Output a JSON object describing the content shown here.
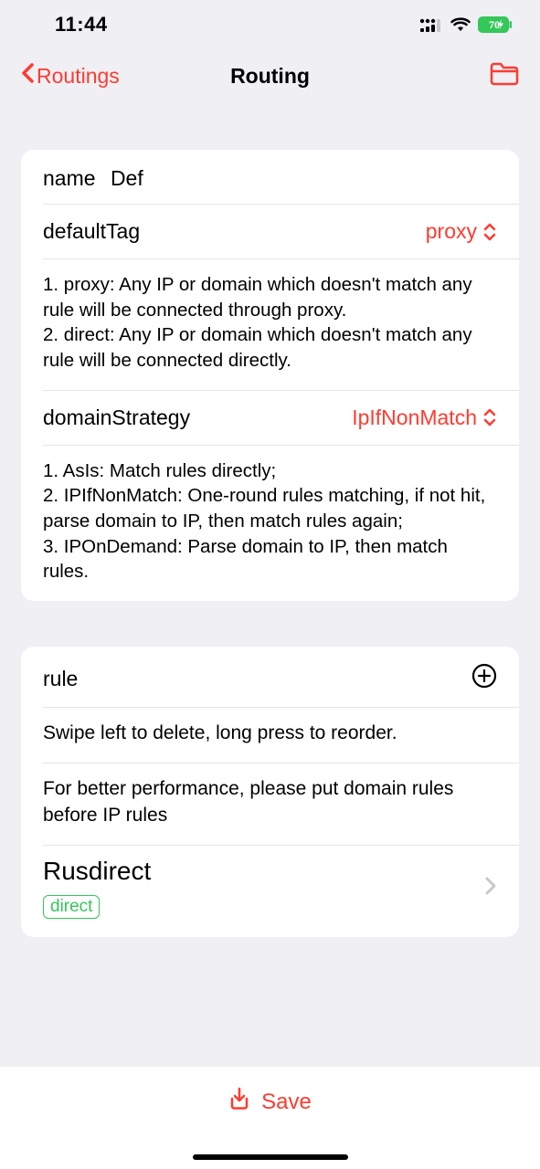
{
  "status": {
    "time": "11:44",
    "battery_text": "70"
  },
  "nav": {
    "back_label": "Routings",
    "title": "Routing"
  },
  "form": {
    "name_label": "name",
    "name_value": "Def",
    "defaultTag_label": "defaultTag",
    "defaultTag_value": "proxy",
    "defaultTag_desc": "1. proxy: Any IP or domain which doesn't match any rule will be connected through proxy.\n2. direct: Any IP or domain which doesn't match any rule will be connected directly.",
    "domainStrategy_label": "domainStrategy",
    "domainStrategy_value": "IpIfNonMatch",
    "domainStrategy_desc": "1. AsIs: Match rules directly;\n2. IPIfNonMatch: One-round rules matching, if not hit, parse domain to IP, then match rules again;\n3. IPOnDemand: Parse domain to IP, then match rules."
  },
  "rules": {
    "header": "rule",
    "hint1": "Swipe left to delete, long press to reorder.",
    "hint2": "For better performance, please put domain rules before IP rules",
    "items": [
      {
        "title": "Rusdirect",
        "tag": "direct"
      }
    ]
  },
  "toolbar": {
    "save_label": "Save"
  }
}
